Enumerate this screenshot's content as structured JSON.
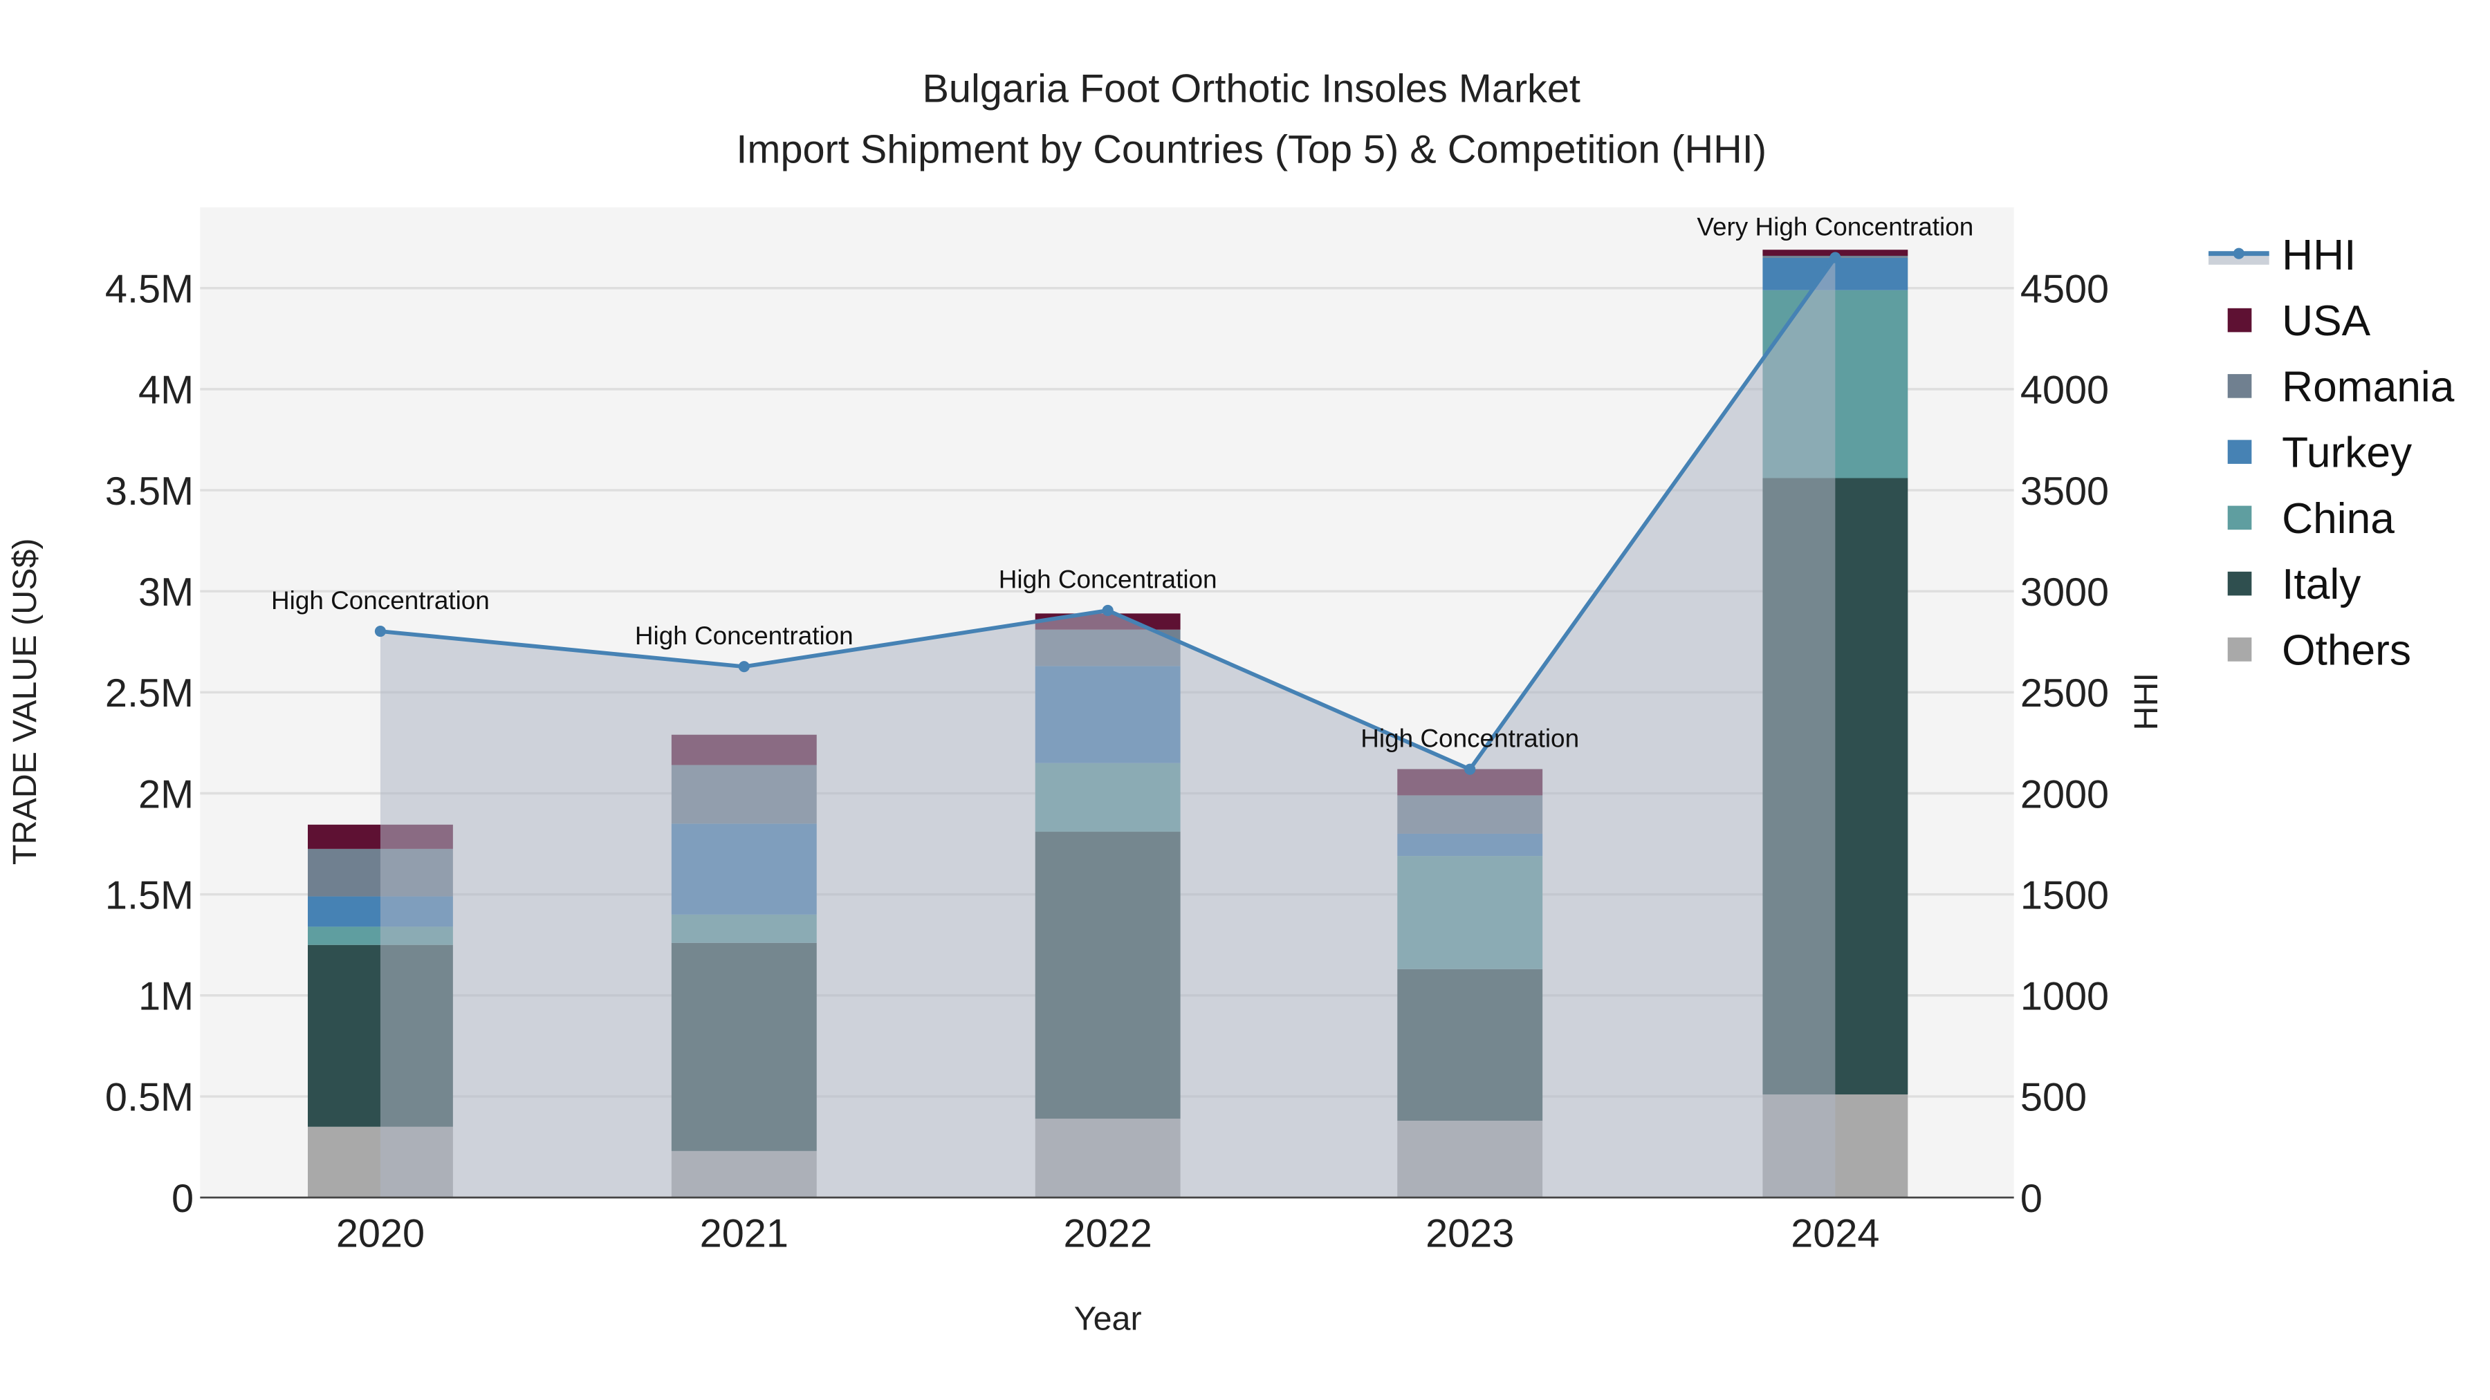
{
  "chart_data": {
    "type": "bar",
    "stacked": true,
    "title": "Bulgaria Foot Orthotic Insoles Market",
    "subtitle": "Import Shipment by Countries (Top 5) & Competition (HHI)",
    "xlabel": "Year",
    "ylabel": "TRADE VALUE (US$)",
    "y2label": "HHI",
    "categories": [
      "2020",
      "2021",
      "2022",
      "2023",
      "2024"
    ],
    "ylim": [
      0,
      4.9
    ],
    "y_unit": "millions US$",
    "yticks": [
      0,
      0.5,
      1,
      1.5,
      2,
      2.5,
      3,
      3.5,
      4,
      4.5
    ],
    "ytick_labels": [
      "0",
      "0.5M",
      "1M",
      "1.5M",
      "2M",
      "2.5M",
      "3M",
      "3.5M",
      "4M",
      "4.5M"
    ],
    "y2lim": [
      0,
      4900
    ],
    "y2ticks": [
      0,
      500,
      1000,
      1500,
      2000,
      2500,
      3000,
      3500,
      4000,
      4500
    ],
    "y2tick_labels": [
      "0",
      "500",
      "1000",
      "1500",
      "2000",
      "2500",
      "3000",
      "3500",
      "4000",
      "4500"
    ],
    "grid": true,
    "legend_position": "right",
    "series": [
      {
        "name": "Others",
        "color": "#a9a9a9",
        "values": [
          0.35,
          0.23,
          0.39,
          0.38,
          0.51
        ]
      },
      {
        "name": "Italy",
        "color": "#2f4f4f",
        "values": [
          0.9,
          1.03,
          1.42,
          0.75,
          3.05
        ]
      },
      {
        "name": "China",
        "color": "#5f9ea0",
        "values": [
          0.09,
          0.14,
          0.34,
          0.56,
          0.93
        ]
      },
      {
        "name": "Turkey",
        "color": "#4682b4",
        "values": [
          0.15,
          0.45,
          0.48,
          0.11,
          0.16
        ]
      },
      {
        "name": "Romania",
        "color": "#708090",
        "values": [
          0.235,
          0.29,
          0.18,
          0.19,
          0.01
        ]
      },
      {
        "name": "USA",
        "color": "#5e1133",
        "values": [
          0.12,
          0.15,
          0.08,
          0.13,
          0.03
        ]
      }
    ],
    "hhi": {
      "name": "HHI",
      "color": "#4682b4",
      "values": [
        2802,
        2627,
        2905,
        2119,
        4651
      ],
      "annotations": [
        "High Concentration",
        "High Concentration",
        "High Concentration",
        "High Concentration",
        "Very High Concentration"
      ]
    },
    "legend": [
      "HHI",
      "USA",
      "Romania",
      "Turkey",
      "China",
      "Italy",
      "Others"
    ]
  }
}
